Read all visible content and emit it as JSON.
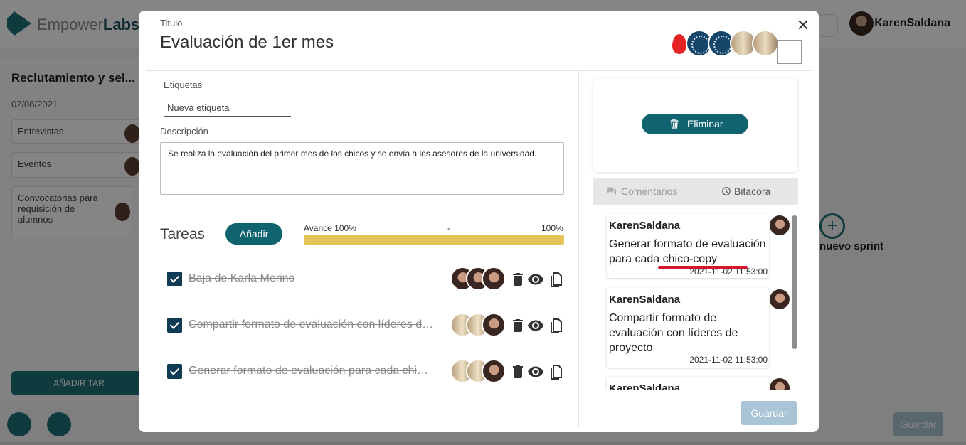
{
  "background": {
    "logo_text_light": "Empower",
    "logo_text_bold": "Labs",
    "user_name": "KarenSaldana",
    "column_title": "Reclutamiento y sel...",
    "column_date": "02/08/2021",
    "cards": [
      "Entrevistas",
      "Eventos",
      "Convocatorias para requisición de alumnos"
    ],
    "add_task_label": "AÑADIR TAR",
    "new_sprint_label": "nuevo sprint",
    "save_label": "Guardar"
  },
  "modal": {
    "title_label": "Titulo",
    "title": "Evaluación de 1er mes",
    "close_symbol": "✕",
    "tags_label": "Etiquetas",
    "tag_placeholder": "Nueva etiqueta",
    "description_label": "Descripción",
    "description": "Se realiza la evaluación del primer mes de los chicos y se envía a los asesores de la universidad.",
    "tasks_title": "Tareas",
    "add_button": "Añadir",
    "progress": {
      "left_label": "Avance 100%",
      "mid_label": "-",
      "right_label": "100%",
      "fraction": 1.0,
      "color": "#e5c55a"
    },
    "tasks": [
      {
        "text": "Baja de Karla Merino",
        "done": true
      },
      {
        "text": "Compartir formato de evaluación con líderes de proyecto",
        "done": true
      },
      {
        "text": "Generar formato de evaluación para cada chico-copy",
        "done": true
      }
    ],
    "delete_button": "Eliminar",
    "tabs": {
      "comments": "Comentarios",
      "log": "Bitacora"
    },
    "comments": [
      {
        "author": "KarenSaldana",
        "text": "Generar formato de evaluación para cada chico-copy",
        "time": "2021-11-02 11:53:00"
      },
      {
        "author": "KarenSaldana",
        "text": "Compartir formato de evaluación con líderes de proyecto",
        "time": "2021-11-02 11:53:00"
      },
      {
        "author": "KarenSaldana",
        "text": "",
        "time": ""
      }
    ],
    "save_button": "Guardar",
    "accent_color": "#0f6470"
  }
}
